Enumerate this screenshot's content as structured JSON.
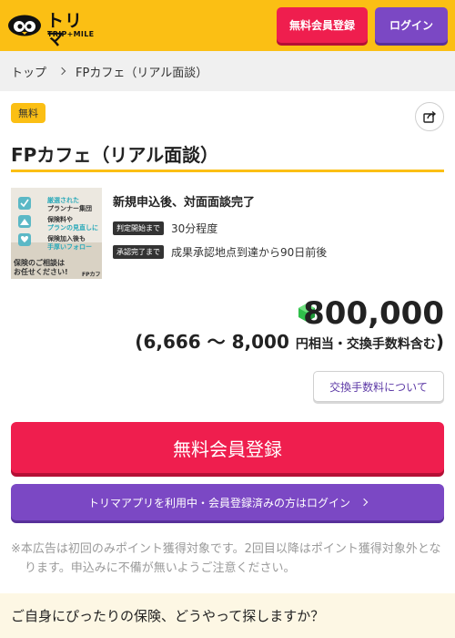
{
  "header": {
    "logo_word": "トリマ",
    "logo_sub": "TRIP+MILE",
    "register_label": "無料会員登録",
    "login_label": "ログイン"
  },
  "breadcrumb": {
    "home": "トップ",
    "current": "FPカフェ（リアル面談）"
  },
  "offer": {
    "badge": "無料",
    "title": "FPカフェ（リアル面談）",
    "thumb": {
      "lines": [
        "厳選された",
        "プランナー集団",
        "保険料や",
        "プランの見直しに",
        "保険加入後も",
        "手厚いフォロー"
      ],
      "bottom": [
        "保険のご相談は",
        "お任せください!"
      ],
      "brand": "FPカフェ"
    },
    "condition": "新規申込後、対面面談完了",
    "judge_tag": "判定開始まで",
    "judge_value": "30分程度",
    "approve_tag": "承認完了まで",
    "approve_value": "成果承認地点到達から90日前後",
    "points": "800,000",
    "yen_open": "(",
    "yen_range": "6,666 〜 8,000",
    "yen_suffix": "円相当・交換手数料含む",
    "yen_close": ")",
    "fee_button": "交換手数料について"
  },
  "actions": {
    "register_main": "無料会員登録",
    "login_main": "トリマアプリを利用中・会員登録済みの方はログイン"
  },
  "note": "※本広告は初回のみポイント獲得対象です。2回目以降はポイント獲得対象外となります。申込みに不備が無いようご注意ください。",
  "banner": "ご自身にぴったりの保険、どうやって探しますか？",
  "colors": {
    "brand_yellow": "#fbbf14",
    "register_red": "#ef1e4e",
    "login_purple": "#7b48c4",
    "gem_green": "#2fbf4a"
  }
}
